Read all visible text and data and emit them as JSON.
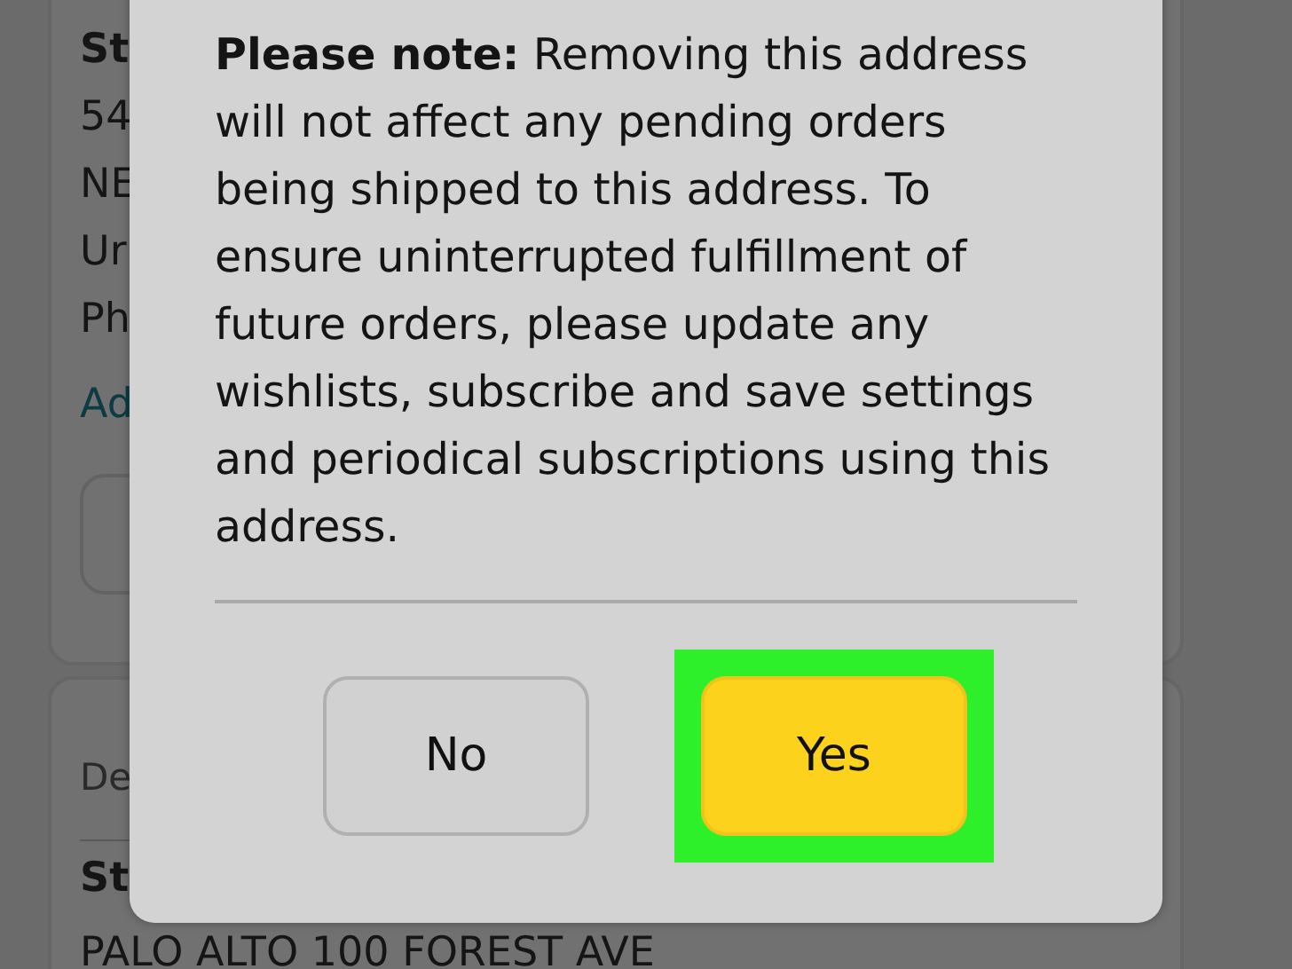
{
  "background_cards": [
    {
      "lines": [
        {
          "text": "St",
          "kind": "heading"
        },
        {
          "text": "54",
          "kind": "plain"
        },
        {
          "text": "NE",
          "kind": "plain"
        },
        {
          "text": "Ur",
          "kind": "plain"
        },
        {
          "text": "Ph",
          "kind": "plain"
        },
        {
          "text": "Ad",
          "kind": "link"
        },
        {
          "kind": "button"
        }
      ]
    },
    {
      "lines": [
        {
          "text": "De",
          "kind": "label"
        },
        {
          "kind": "divider"
        },
        {
          "text": "St",
          "kind": "heading"
        },
        {
          "text": "PALO ALTO 100 FOREST AVE",
          "kind": "plain"
        }
      ]
    }
  ],
  "dialog": {
    "message": "**Please note:** Removing this address will not affect any pending orders being shipped to this address. To ensure uninterrupted fulfillment of future orders, please update any wishlists, subscribe and save settings and periodical subscriptions using this address.",
    "buttons": [
      {
        "label": "No",
        "kind": "secondary",
        "highlighted": false
      },
      {
        "label": "Yes",
        "kind": "primary",
        "highlighted": true
      }
    ]
  }
}
